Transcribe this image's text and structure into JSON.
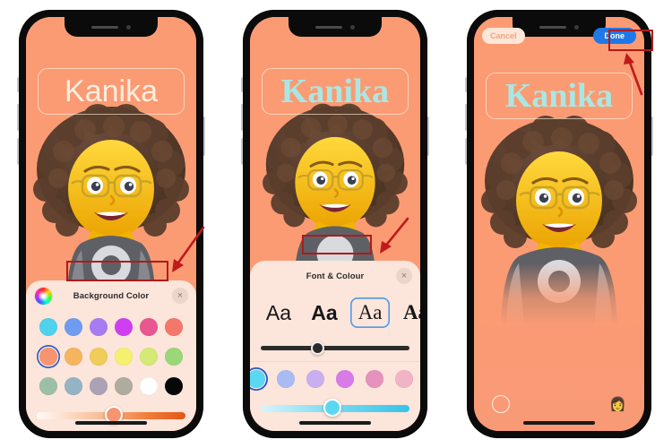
{
  "scene": {
    "description": "Three iPhone screenshots showing Memoji contact-photo editor steps",
    "background_color": "#ffffff"
  },
  "phones": [
    {
      "id": "phone-1",
      "screen_bg": "#fb9b74",
      "name_text": "Kanika",
      "name_style": "sans",
      "name_color": "#fdeede",
      "sheet": {
        "title": "Background Color",
        "close_label": "×",
        "wheel_icon": "color-wheel-icon",
        "swatch_rows": [
          [
            {
              "color": "#4fd2ee",
              "selected": false
            },
            {
              "color": "#6f9bf0",
              "selected": false
            },
            {
              "color": "#a77cf2",
              "selected": false
            },
            {
              "color": "#cf3ef0",
              "selected": false
            },
            {
              "color": "#e8578f",
              "selected": false
            },
            {
              "color": "#f4776b",
              "selected": false
            }
          ],
          [
            {
              "color": "#f79570",
              "selected": true
            },
            {
              "color": "#f6b45e",
              "selected": false
            },
            {
              "color": "#f0cc58",
              "selected": false
            },
            {
              "color": "#f6f070",
              "selected": false
            },
            {
              "color": "#d4ea74",
              "selected": false
            },
            {
              "color": "#9ad877",
              "selected": false
            }
          ],
          [
            {
              "color": "#9cbfa8",
              "selected": false
            },
            {
              "color": "#94b4c4",
              "selected": false
            },
            {
              "color": "#aca2b6",
              "selected": false
            },
            {
              "color": "#adac9e",
              "selected": false
            },
            {
              "color": "#ffffff",
              "selected": false
            },
            {
              "color": "#070707",
              "selected": false
            }
          ]
        ],
        "slider": {
          "name": "brightness-slider",
          "gradient_from": "#fffaf6",
          "gradient_to": "#e2571a",
          "value_percent": 50,
          "knob_color": "#f79570"
        }
      },
      "annotations": {
        "highlight_label": "Background Color",
        "arrow": "red-arrow-down-left"
      }
    },
    {
      "id": "phone-2",
      "screen_bg": "#fb9b74",
      "name_text": "Kanika",
      "name_style": "serif",
      "name_color": "#a8e8e4",
      "sheet": {
        "title": "Font & Colour",
        "close_label": "×",
        "fonts": [
          {
            "label": "Aa",
            "style": "sans",
            "selected": false
          },
          {
            "label": "Aa",
            "style": "sans-bold",
            "selected": false
          },
          {
            "label": "Aa",
            "style": "serif",
            "selected": true
          },
          {
            "label": "Aa",
            "style": "serif-bold",
            "selected": false
          }
        ],
        "weight_slider": {
          "name": "font-weight-slider",
          "track_color": "#2b2b2b",
          "value_percent": 36,
          "knob_color": "#2b2b2b"
        },
        "colors": [
          {
            "color": "#5ad8f2",
            "selected": true
          },
          {
            "color": "#a8bbf2",
            "selected": false
          },
          {
            "color": "#c9aef0",
            "selected": false
          },
          {
            "color": "#d87ae8",
            "selected": false
          },
          {
            "color": "#e592bc",
            "selected": false
          },
          {
            "color": "#f1b4c6",
            "selected": false
          },
          {
            "color": "#f5cdb0",
            "selected": false
          }
        ],
        "tint_slider": {
          "name": "tint-slider",
          "gradient_from": "#d9f4fb",
          "gradient_to": "#36c3e8",
          "value_percent": 47,
          "knob_color": "#5ad8f2"
        }
      },
      "annotations": {
        "highlight_label": "Font & Colour",
        "arrow": "red-arrow-down-left"
      }
    },
    {
      "id": "phone-3",
      "screen_bg": "#fb9b74",
      "name_text": "Kanika",
      "name_style": "serif",
      "name_color": "#a8e8e4",
      "topbar": {
        "cancel_label": "Cancel",
        "done_label": "Done",
        "done_color": "#1f78e8",
        "cancel_color": "#f0a37f"
      },
      "bottombar": {
        "shutter_icon": "camera-shutter-icon",
        "memoji_icon": "memoji-face-icon",
        "memoji_glyph": "👩"
      },
      "annotations": {
        "highlight_label": "Done",
        "arrow": "red-arrow-up"
      }
    }
  ]
}
